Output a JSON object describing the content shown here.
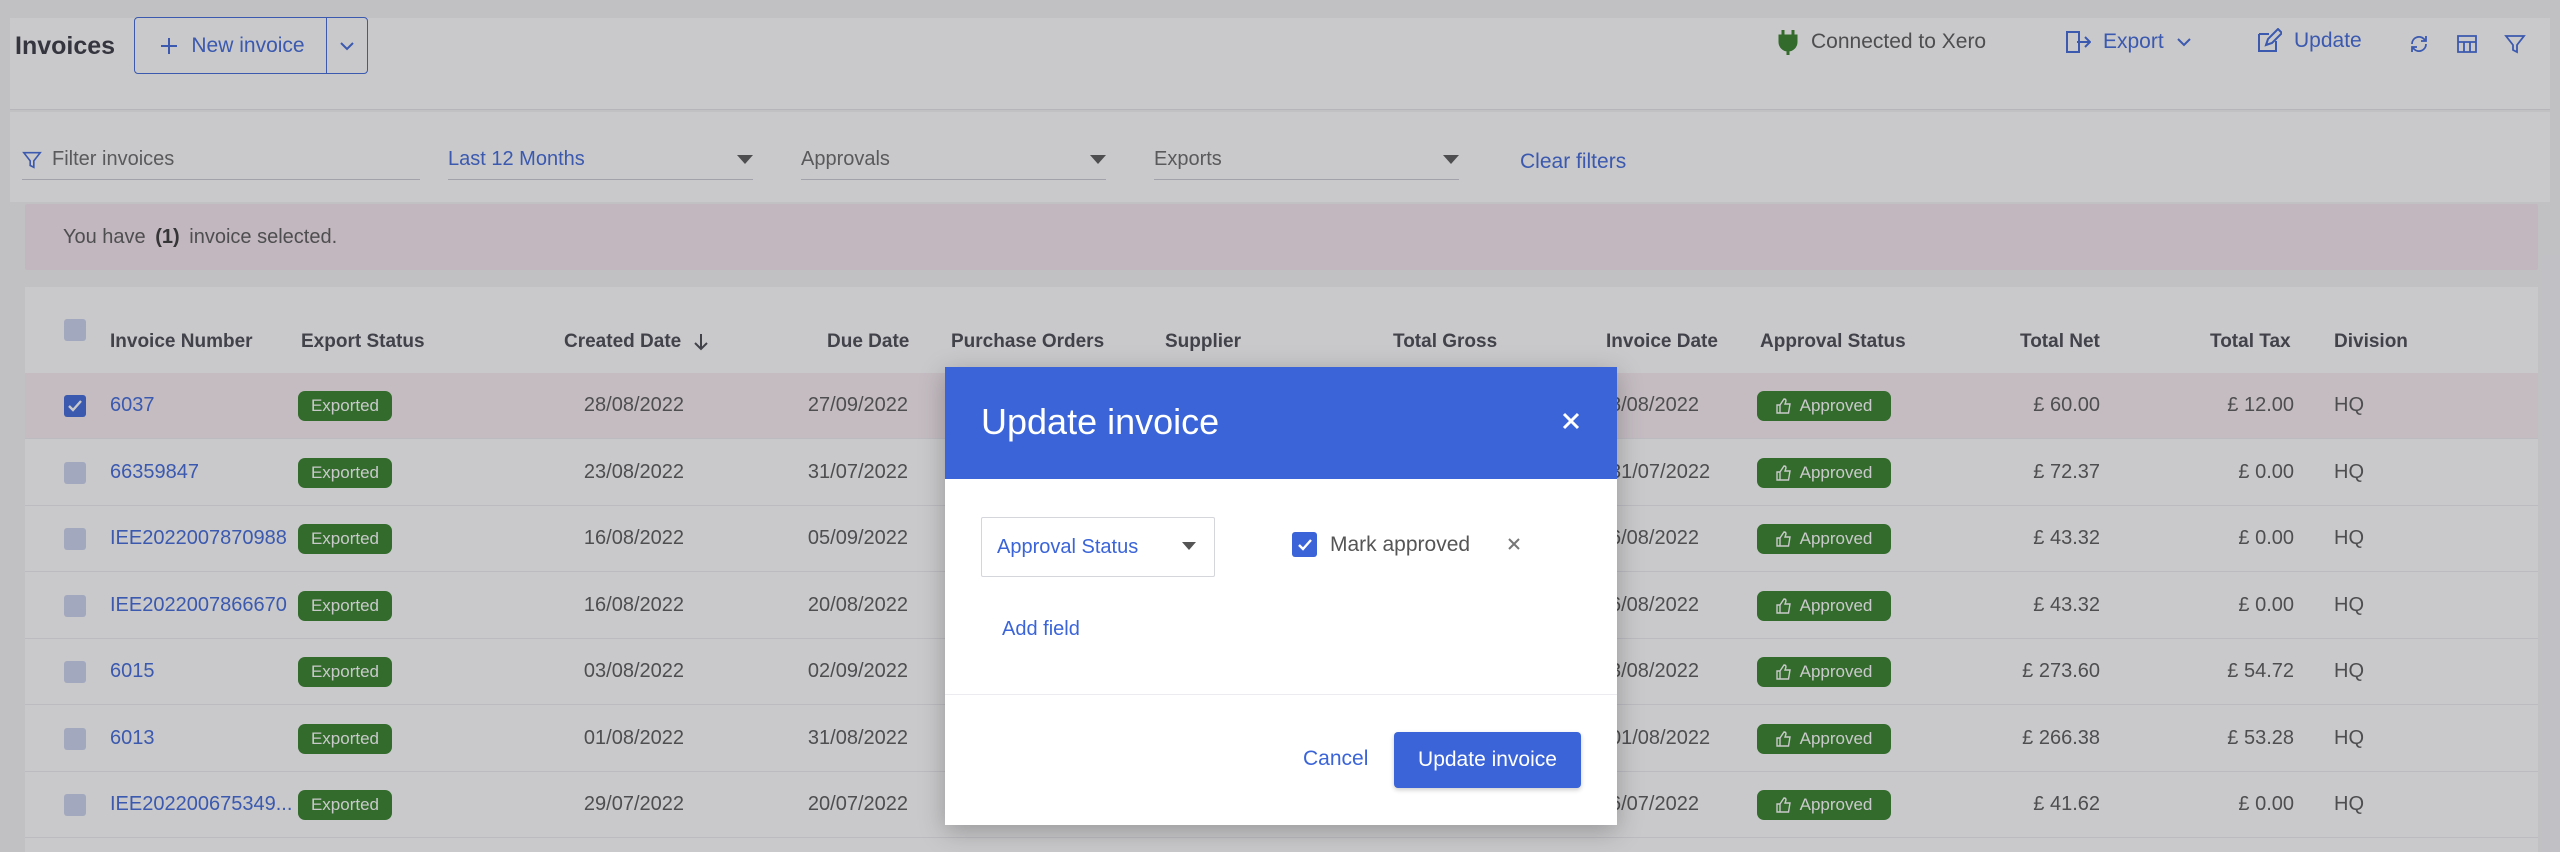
{
  "header": {
    "title": "Invoices",
    "new_invoice_label": "New invoice",
    "connection_label": "Connected to Xero",
    "export_label": "Export",
    "update_label": "Update"
  },
  "filters": {
    "search_placeholder": "Filter invoices",
    "date_range": "Last 12 Months",
    "approvals": "Approvals",
    "exports": "Exports",
    "clear_label": "Clear filters"
  },
  "banner": {
    "prefix": "You have",
    "count": "(1)",
    "suffix": "invoice selected."
  },
  "table": {
    "columns": [
      "Invoice Number",
      "Export Status",
      "Created Date",
      "Due Date",
      "Purchase Orders",
      "Supplier",
      "Total Gross",
      "Invoice Date",
      "Approval Status",
      "Total Net",
      "Total Tax",
      "Division"
    ],
    "rows": [
      {
        "selected": true,
        "number": "6037",
        "export": "Exported",
        "created": "28/08/2022",
        "due": "27/09/2022",
        "invoice_date": "8/08/2022",
        "approval": "Approved",
        "net": "£ 60.00",
        "tax": "£ 12.00",
        "division": "HQ"
      },
      {
        "selected": false,
        "number": "66359847",
        "export": "Exported",
        "created": "23/08/2022",
        "due": "31/07/2022",
        "invoice_date": "31/07/2022",
        "approval": "Approved",
        "net": "£ 72.37",
        "tax": "£ 0.00",
        "division": "HQ"
      },
      {
        "selected": false,
        "number": "IEE2022007870988",
        "export": "Exported",
        "created": "16/08/2022",
        "due": "05/09/2022",
        "invoice_date": "6/08/2022",
        "approval": "Approved",
        "net": "£ 43.32",
        "tax": "£ 0.00",
        "division": "HQ"
      },
      {
        "selected": false,
        "number": "IEE2022007866670",
        "export": "Exported",
        "created": "16/08/2022",
        "due": "20/08/2022",
        "invoice_date": "6/08/2022",
        "approval": "Approved",
        "net": "£ 43.32",
        "tax": "£ 0.00",
        "division": "HQ"
      },
      {
        "selected": false,
        "number": "6015",
        "export": "Exported",
        "created": "03/08/2022",
        "due": "02/09/2022",
        "invoice_date": "3/08/2022",
        "approval": "Approved",
        "net": "£ 273.60",
        "tax": "£ 54.72",
        "division": "HQ"
      },
      {
        "selected": false,
        "number": "6013",
        "export": "Exported",
        "created": "01/08/2022",
        "due": "31/08/2022",
        "invoice_date": "01/08/2022",
        "approval": "Approved",
        "net": "£ 266.38",
        "tax": "£ 53.28",
        "division": "HQ"
      },
      {
        "selected": false,
        "number": "IEE202200675349...",
        "export": "Exported",
        "created": "29/07/2022",
        "due": "20/07/2022",
        "invoice_date": "6/07/2022",
        "approval": "Approved",
        "net": "£ 41.62",
        "tax": "£ 0.00",
        "division": "HQ"
      }
    ]
  },
  "modal": {
    "title": "Update invoice",
    "field_select": "Approval Status",
    "mark_label": "Mark approved",
    "add_field": "Add field",
    "cancel": "Cancel",
    "submit": "Update invoice"
  },
  "colors": {
    "accent": "#3a64d8",
    "badge_green": "#2e7d22",
    "banner_bg": "#f5e6ee"
  }
}
